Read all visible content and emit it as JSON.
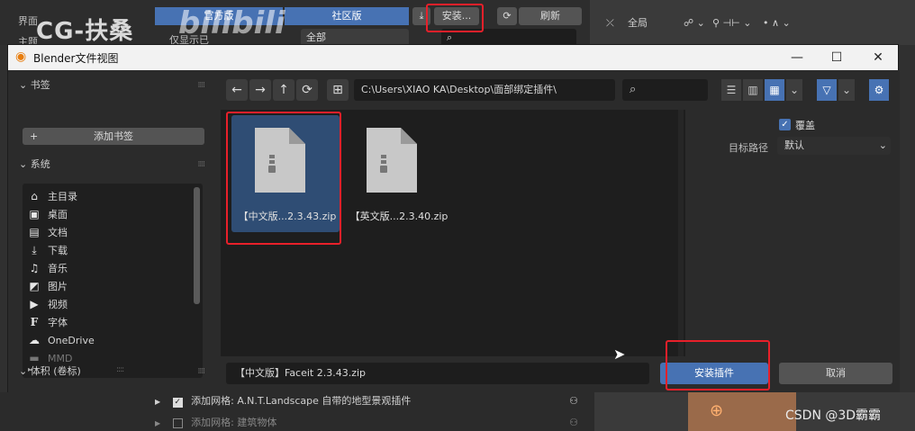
{
  "background": {
    "prefs_label_1": "界面",
    "prefs_label_2": "主题",
    "seg_official": "官方版",
    "seg_community": "社区版",
    "install_button": "安装...",
    "refresh_button": "刷新",
    "filter_text": "仅显示已",
    "all_dropdown": "全部",
    "watermark": "CG-扶桑",
    "watermark_logo": "bilibili",
    "viewport_global": "全局",
    "addon_rows": [
      {
        "checked": true,
        "text": "添加网格: A.N.T.Landscape 自带的地型景观插件"
      },
      {
        "checked": false,
        "text": "添加网格: 建筑物体"
      }
    ],
    "csdn_mark": "CSDN @3D霸霸"
  },
  "dialog": {
    "title": "Blender文件视图",
    "sidebar": {
      "bookmarks_header": "书签",
      "add_bookmark": "添加书签",
      "system_header": "系统",
      "system_items": [
        {
          "icon": "home-icon",
          "glyph": "⌂",
          "label": "主目录"
        },
        {
          "icon": "desktop-icon",
          "glyph": "▣",
          "label": "桌面"
        },
        {
          "icon": "document-icon",
          "glyph": "▤",
          "label": "文档"
        },
        {
          "icon": "download-icon",
          "glyph": "⤓",
          "label": "下载"
        },
        {
          "icon": "music-icon",
          "glyph": "♫",
          "label": "音乐"
        },
        {
          "icon": "picture-icon",
          "glyph": "◩",
          "label": "图片"
        },
        {
          "icon": "video-icon",
          "glyph": "▶",
          "label": "视频"
        },
        {
          "icon": "font-icon",
          "glyph": "F",
          "label": "字体"
        },
        {
          "icon": "cloud-icon",
          "glyph": "☁",
          "label": "OneDrive"
        },
        {
          "icon": "folder-icon",
          "glyph": "▬",
          "label": "MMD"
        }
      ],
      "volumes_header": "体积 (卷标)"
    },
    "path": "C:\\Users\\XIAO KA\\Desktop\\面部绑定插件\\",
    "search_placeholder": "",
    "files": [
      {
        "name": "【中文版...2.3.43.zip",
        "selected": true
      },
      {
        "name": "【英文版...2.3.40.zip",
        "selected": false
      }
    ],
    "options": {
      "overwrite_label": "覆盖",
      "target_path_label": "目标路径",
      "target_path_value": "默认"
    },
    "filename_value": "【中文版】Faceit 2.3.43.zip",
    "install_addon_button": "安装插件",
    "cancel_button": "取消"
  },
  "colors": {
    "accent": "#4772b3",
    "highlight_box": "#e8202a",
    "panel_bg": "#2b2b2b"
  }
}
